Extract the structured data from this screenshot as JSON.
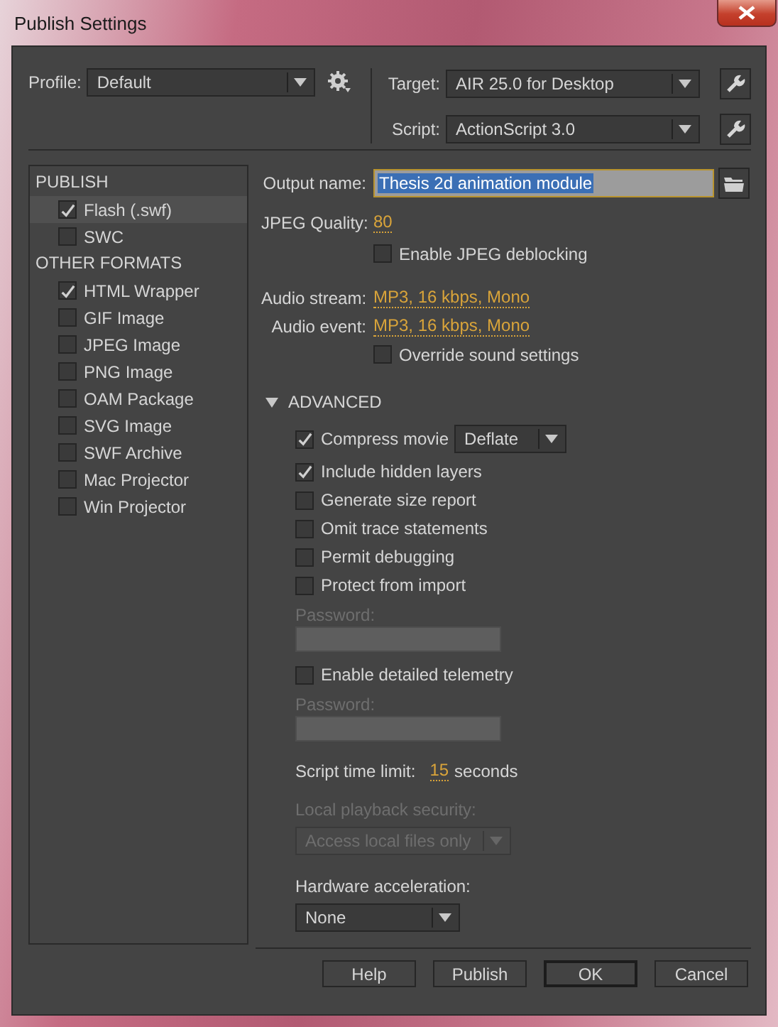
{
  "window": {
    "title": "Publish Settings"
  },
  "profile": {
    "label": "Profile:",
    "value": "Default"
  },
  "target": {
    "label": "Target:",
    "value": "AIR 25.0 for Desktop"
  },
  "script": {
    "label": "Script:",
    "value": "ActionScript 3.0"
  },
  "sidebar": {
    "sections": [
      {
        "title": "PUBLISH",
        "items": [
          {
            "label": "Flash (.swf)",
            "checked": true,
            "selected": true
          },
          {
            "label": "SWC",
            "checked": false,
            "selected": false
          }
        ]
      },
      {
        "title": "OTHER FORMATS",
        "items": [
          {
            "label": "HTML Wrapper",
            "checked": true,
            "selected": false
          },
          {
            "label": "GIF Image",
            "checked": false,
            "selected": false
          },
          {
            "label": "JPEG Image",
            "checked": false,
            "selected": false
          },
          {
            "label": "PNG Image",
            "checked": false,
            "selected": false
          },
          {
            "label": "OAM Package",
            "checked": false,
            "selected": false
          },
          {
            "label": "SVG Image",
            "checked": false,
            "selected": false
          },
          {
            "label": "SWF Archive",
            "checked": false,
            "selected": false
          },
          {
            "label": "Mac Projector",
            "checked": false,
            "selected": false
          },
          {
            "label": "Win Projector",
            "checked": false,
            "selected": false
          }
        ]
      }
    ]
  },
  "output_name": {
    "label": "Output name:",
    "value": "Thesis 2d animation module",
    "selected": true
  },
  "jpeg_quality": {
    "label": "JPEG Quality:",
    "value": "80"
  },
  "jpeg_deblocking": {
    "label": "Enable JPEG deblocking",
    "checked": false
  },
  "audio_stream": {
    "label": "Audio stream:",
    "value": "MP3, 16 kbps, Mono"
  },
  "audio_event": {
    "label": "Audio event:",
    "value": "MP3, 16 kbps, Mono"
  },
  "override_sound": {
    "label": "Override sound settings",
    "checked": false
  },
  "advanced": {
    "label": "ADVANCED",
    "expanded": true,
    "rows": [
      {
        "kind": "checkbox",
        "label": "Compress movie",
        "checked": true,
        "dropdown": "Deflate"
      },
      {
        "kind": "checkbox",
        "label": "Include hidden layers",
        "checked": true
      },
      {
        "kind": "checkbox",
        "label": "Generate size report",
        "checked": false
      },
      {
        "kind": "checkbox",
        "label": "Omit trace statements",
        "checked": false
      },
      {
        "kind": "checkbox",
        "label": "Permit debugging",
        "checked": false
      },
      {
        "kind": "checkbox",
        "label": "Protect from import",
        "checked": false
      },
      {
        "kind": "password",
        "label": "Password:",
        "disabled": true
      },
      {
        "kind": "checkbox",
        "label": "Enable detailed telemetry",
        "checked": false
      },
      {
        "kind": "password",
        "label": "Password:",
        "disabled": true
      },
      {
        "kind": "time_limit",
        "label": "Script time limit:",
        "value": "15",
        "unit": "seconds"
      },
      {
        "kind": "dropdown",
        "label": "Local playback security:",
        "value": "Access local files only",
        "disabled": true
      },
      {
        "kind": "dropdown",
        "label": "Hardware acceleration:",
        "value": "None",
        "disabled": false
      }
    ]
  },
  "buttons": [
    {
      "label": "Help",
      "default": false
    },
    {
      "label": "Publish",
      "default": false
    },
    {
      "label": "OK",
      "default": true
    },
    {
      "label": "Cancel",
      "default": false
    }
  ]
}
